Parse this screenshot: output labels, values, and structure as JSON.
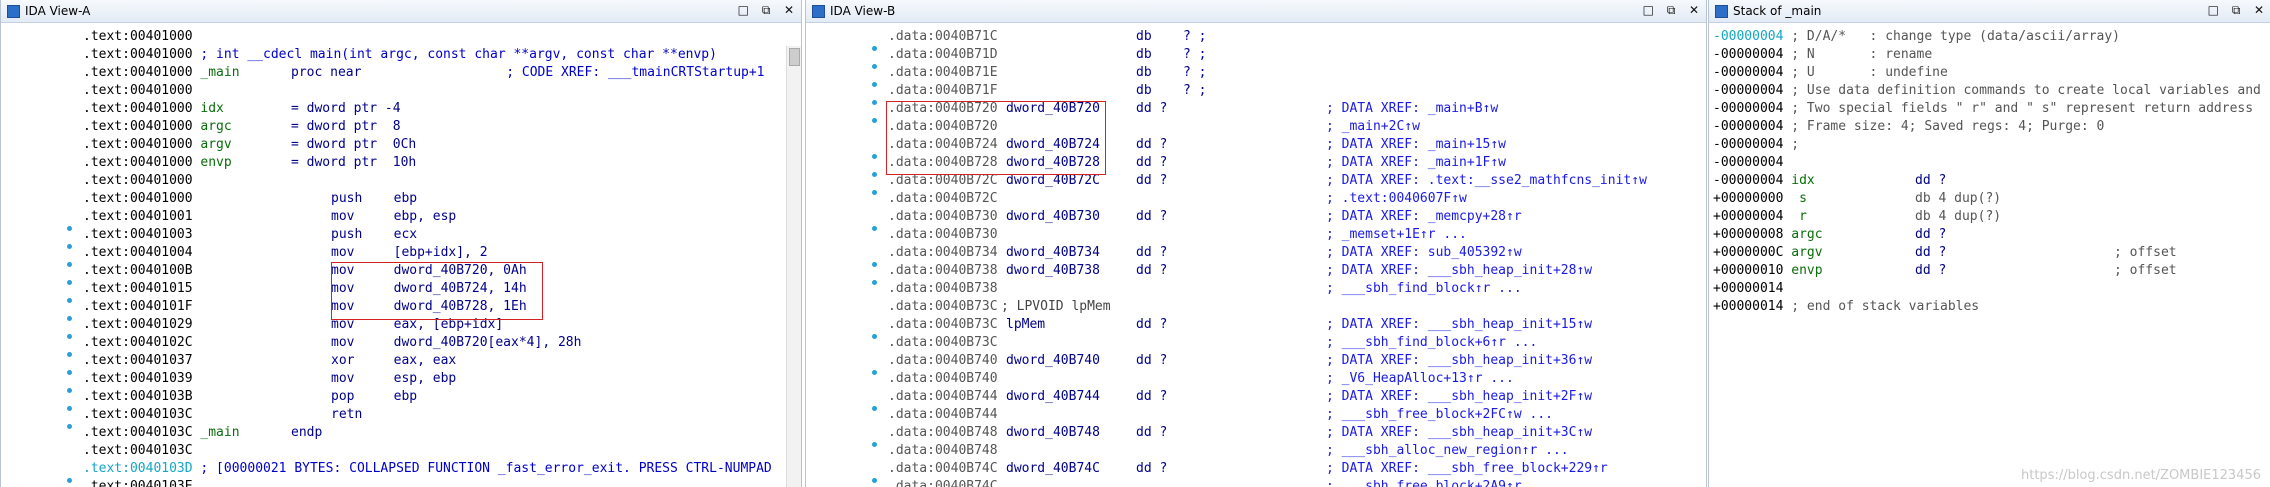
{
  "paneA": {
    "title": "IDA View-A",
    "lines": [
      {
        "a": ".text:00401000",
        "b": "",
        "c": "",
        "d": "",
        "bp": false
      },
      {
        "a": ".text:00401000",
        "b": " ; int __cdecl main(int argc, const char **argv, const char **envp)",
        "c": "",
        "d": "",
        "bp": false,
        "cls": "cmtA"
      },
      {
        "a": ".text:00401000",
        "b": " _main",
        "c": "proc near",
        "d": "                ; CODE XREF: ___tmainCRTStartup+1",
        "bp": false
      },
      {
        "a": ".text:00401000",
        "b": "",
        "c": "",
        "d": "",
        "bp": false
      },
      {
        "a": ".text:00401000",
        "b": " idx",
        "c": "= dword ptr -4",
        "d": "",
        "bp": false
      },
      {
        "a": ".text:00401000",
        "b": " argc",
        "c": "= dword ptr  8",
        "d": "",
        "bp": false
      },
      {
        "a": ".text:00401000",
        "b": " argv",
        "c": "= dword ptr  0Ch",
        "d": "",
        "bp": false
      },
      {
        "a": ".text:00401000",
        "b": " envp",
        "c": "= dword ptr  10h",
        "d": "",
        "bp": false
      },
      {
        "a": ".text:00401000",
        "b": "",
        "c": "",
        "d": "",
        "bp": false
      },
      {
        "a": ".text:00401000",
        "b": "",
        "c": "push    ebp",
        "d": "",
        "bp": false
      },
      {
        "a": ".text:00401001",
        "b": "",
        "c": "mov     ebp, esp",
        "d": "",
        "bp": true
      },
      {
        "a": ".text:00401003",
        "b": "",
        "c": "push    ecx",
        "d": "",
        "bp": true
      },
      {
        "a": ".text:00401004",
        "b": "",
        "c": "mov     [ebp+idx], 2",
        "d": "",
        "bp": true
      },
      {
        "a": ".text:0040100B",
        "b": "",
        "c": "mov     dword_40B720, 0Ah",
        "d": "",
        "bp": true
      },
      {
        "a": ".text:00401015",
        "b": "",
        "c": "mov     dword_40B724, 14h",
        "d": "",
        "bp": true
      },
      {
        "a": ".text:0040101F",
        "b": "",
        "c": "mov     dword_40B728, 1Eh",
        "d": "",
        "bp": true
      },
      {
        "a": ".text:00401029",
        "b": "",
        "c": "mov     eax, [ebp+idx]",
        "d": "",
        "bp": true
      },
      {
        "a": ".text:0040102C",
        "b": "",
        "c": "mov     dword_40B720[eax*4], 28h",
        "d": "",
        "bp": true
      },
      {
        "a": ".text:00401037",
        "b": "",
        "c": "xor     eax, eax",
        "d": "",
        "bp": true
      },
      {
        "a": ".text:00401039",
        "b": "",
        "c": "mov     esp, ebp",
        "d": "",
        "bp": true
      },
      {
        "a": ".text:0040103B",
        "b": "",
        "c": "pop     ebp",
        "d": "",
        "bp": true
      },
      {
        "a": ".text:0040103C",
        "b": "",
        "c": "retn",
        "d": "",
        "bp": true
      },
      {
        "a": ".text:0040103C",
        "b": " _main",
        "c": "endp",
        "d": "",
        "bp": false
      },
      {
        "a": ".text:0040103C",
        "b": "",
        "c": "",
        "d": "",
        "bp": false
      },
      {
        "a": ".text:0040103D",
        "b": " ; [00000021 BYTES: COLLAPSED FUNCTION _fast_error_exit. PRESS CTRL-NUMPAD",
        "c": "",
        "d": "",
        "bp": true,
        "hl": true
      },
      {
        "a": ".text:0040103E",
        "b": "",
        "c": "",
        "d": "",
        "bp": false
      }
    ]
  },
  "paneB": {
    "title": "IDA View-B",
    "lines": [
      {
        "a": ".data:0040B71C",
        "n": "",
        "t": "db    ? ;",
        "x": "",
        "bp": true
      },
      {
        "a": ".data:0040B71D",
        "n": "",
        "t": "db    ? ;",
        "x": "",
        "bp": true
      },
      {
        "a": ".data:0040B71E",
        "n": "",
        "t": "db    ? ;",
        "x": "",
        "bp": true
      },
      {
        "a": ".data:0040B71F",
        "n": "",
        "t": "db    ? ;",
        "x": "",
        "bp": true
      },
      {
        "a": ".data:0040B720",
        "n": "dword_40B720",
        "t": "dd ?",
        "x": "; DATA XREF: _main+B↑w",
        "bp": true
      },
      {
        "a": ".data:0040B720",
        "n": "",
        "t": "",
        "x": "; _main+2C↑w",
        "bp": false
      },
      {
        "a": ".data:0040B724",
        "n": "dword_40B724",
        "t": "dd ?",
        "x": "; DATA XREF: _main+15↑w",
        "bp": true
      },
      {
        "a": ".data:0040B728",
        "n": "dword_40B728",
        "t": "dd ?",
        "x": "; DATA XREF: _main+1F↑w",
        "bp": true
      },
      {
        "a": ".data:0040B72C",
        "n": "dword_40B72C",
        "t": "dd ?",
        "x": "; DATA XREF: .text:__sse2_mathfcns_init↑w",
        "bp": true
      },
      {
        "a": ".data:0040B72C",
        "n": "",
        "t": "",
        "x": "; .text:0040607F↑w",
        "bp": false
      },
      {
        "a": ".data:0040B730",
        "n": "dword_40B730",
        "t": "dd ?",
        "x": "; DATA XREF: _memcpy+28↑r",
        "bp": true
      },
      {
        "a": ".data:0040B730",
        "n": "",
        "t": "",
        "x": "; _memset+1E↑r ...",
        "bp": false
      },
      {
        "a": ".data:0040B734",
        "n": "dword_40B734",
        "t": "dd ?",
        "x": "; DATA XREF: sub_405392↑w",
        "bp": true
      },
      {
        "a": ".data:0040B738",
        "n": "dword_40B738",
        "t": "dd ?",
        "x": "; DATA XREF: ___sbh_heap_init+28↑w",
        "bp": true
      },
      {
        "a": ".data:0040B738",
        "n": "",
        "t": "",
        "x": "; ___sbh_find_block↑r ...",
        "bp": false
      },
      {
        "a": ".data:0040B73C",
        "n": "; LPVOID lpMem",
        "t": "",
        "x": "",
        "bp": false
      },
      {
        "a": ".data:0040B73C",
        "n": "lpMem",
        "t": "dd ?",
        "x": "; DATA XREF: ___sbh_heap_init+15↑w",
        "bp": true
      },
      {
        "a": ".data:0040B73C",
        "n": "",
        "t": "",
        "x": "; ___sbh_find_block+6↑r ...",
        "bp": false
      },
      {
        "a": ".data:0040B740",
        "n": "dword_40B740",
        "t": "dd ?",
        "x": "; DATA XREF: ___sbh_heap_init+36↑w",
        "bp": true
      },
      {
        "a": ".data:0040B740",
        "n": "",
        "t": "",
        "x": "; _V6_HeapAlloc+13↑r ...",
        "bp": false
      },
      {
        "a": ".data:0040B744",
        "n": "dword_40B744",
        "t": "dd ?",
        "x": "; DATA XREF: ___sbh_heap_init+2F↑w",
        "bp": true
      },
      {
        "a": ".data:0040B744",
        "n": "",
        "t": "",
        "x": "; ___sbh_free_block+2FC↑w ...",
        "bp": false
      },
      {
        "a": ".data:0040B748",
        "n": "dword_40B748",
        "t": "dd ?",
        "x": "; DATA XREF: ___sbh_heap_init+3C↑w",
        "bp": true
      },
      {
        "a": ".data:0040B748",
        "n": "",
        "t": "",
        "x": "; ___sbh_alloc_new_region↑r ...",
        "bp": false
      },
      {
        "a": ".data:0040B74C",
        "n": "dword_40B74C",
        "t": "dd ?",
        "x": "; DATA XREF: ___sbh_free_block+229↑r",
        "bp": true
      },
      {
        "a": ".data:0040B74C",
        "n": "",
        "t": "",
        "x": "; ___sbh_free_block+2A9↑r",
        "bp": false
      }
    ]
  },
  "paneS": {
    "title": "Stack of _main",
    "lines": [
      {
        "a": "-00000004",
        "b": " ; D/A/*   : change type (data/ascii/array)",
        "c": "",
        "d": "",
        "kind": "cmt",
        "hl": true
      },
      {
        "a": "-00000004",
        "b": " ; N       : rename",
        "c": "",
        "d": "",
        "kind": "cmt"
      },
      {
        "a": "-00000004",
        "b": " ; U       : undefine",
        "c": "",
        "d": "",
        "kind": "cmt"
      },
      {
        "a": "-00000004",
        "b": " ; Use data definition commands to create local variables and",
        "c": "",
        "d": "",
        "kind": "cmt"
      },
      {
        "a": "-00000004",
        "b": " ; Two special fields \" r\" and \" s\" represent return address",
        "c": "",
        "d": "",
        "kind": "cmt"
      },
      {
        "a": "-00000004",
        "b": " ; Frame size: 4; Saved regs: 4; Purge: 0",
        "c": "",
        "d": "",
        "kind": "cmt"
      },
      {
        "a": "-00000004",
        "b": " ;",
        "c": "",
        "d": "",
        "kind": "cmt"
      },
      {
        "a": "-00000004",
        "b": "",
        "c": "",
        "d": "",
        "kind": "cmt"
      },
      {
        "a": "-00000004",
        "b": " idx",
        "c": "dd ?",
        "d": "",
        "kind": "var"
      },
      {
        "a": "+00000000",
        "b": "  s",
        "c": "db 4 dup(?)",
        "d": "",
        "kind": "spec"
      },
      {
        "a": "+00000004",
        "b": "  r",
        "c": "db 4 dup(?)",
        "d": "",
        "kind": "spec"
      },
      {
        "a": "+00000008",
        "b": " argc",
        "c": "dd ?",
        "d": "",
        "kind": "var"
      },
      {
        "a": "+0000000C",
        "b": " argv",
        "c": "dd ?",
        "d": "; offset",
        "kind": "var"
      },
      {
        "a": "+00000010",
        "b": " envp",
        "c": "dd ?",
        "d": "; offset",
        "kind": "var"
      },
      {
        "a": "+00000014",
        "b": "",
        "c": "",
        "d": "",
        "kind": "cmt"
      },
      {
        "a": "+00000014",
        "b": " ; end of stack variables",
        "c": "",
        "d": "",
        "kind": "cmt"
      }
    ]
  },
  "controls": {
    "min": "□",
    "restore": "⧉",
    "close": "✕"
  },
  "watermark": "https://blog.csdn.net/ZOMBIE123456"
}
